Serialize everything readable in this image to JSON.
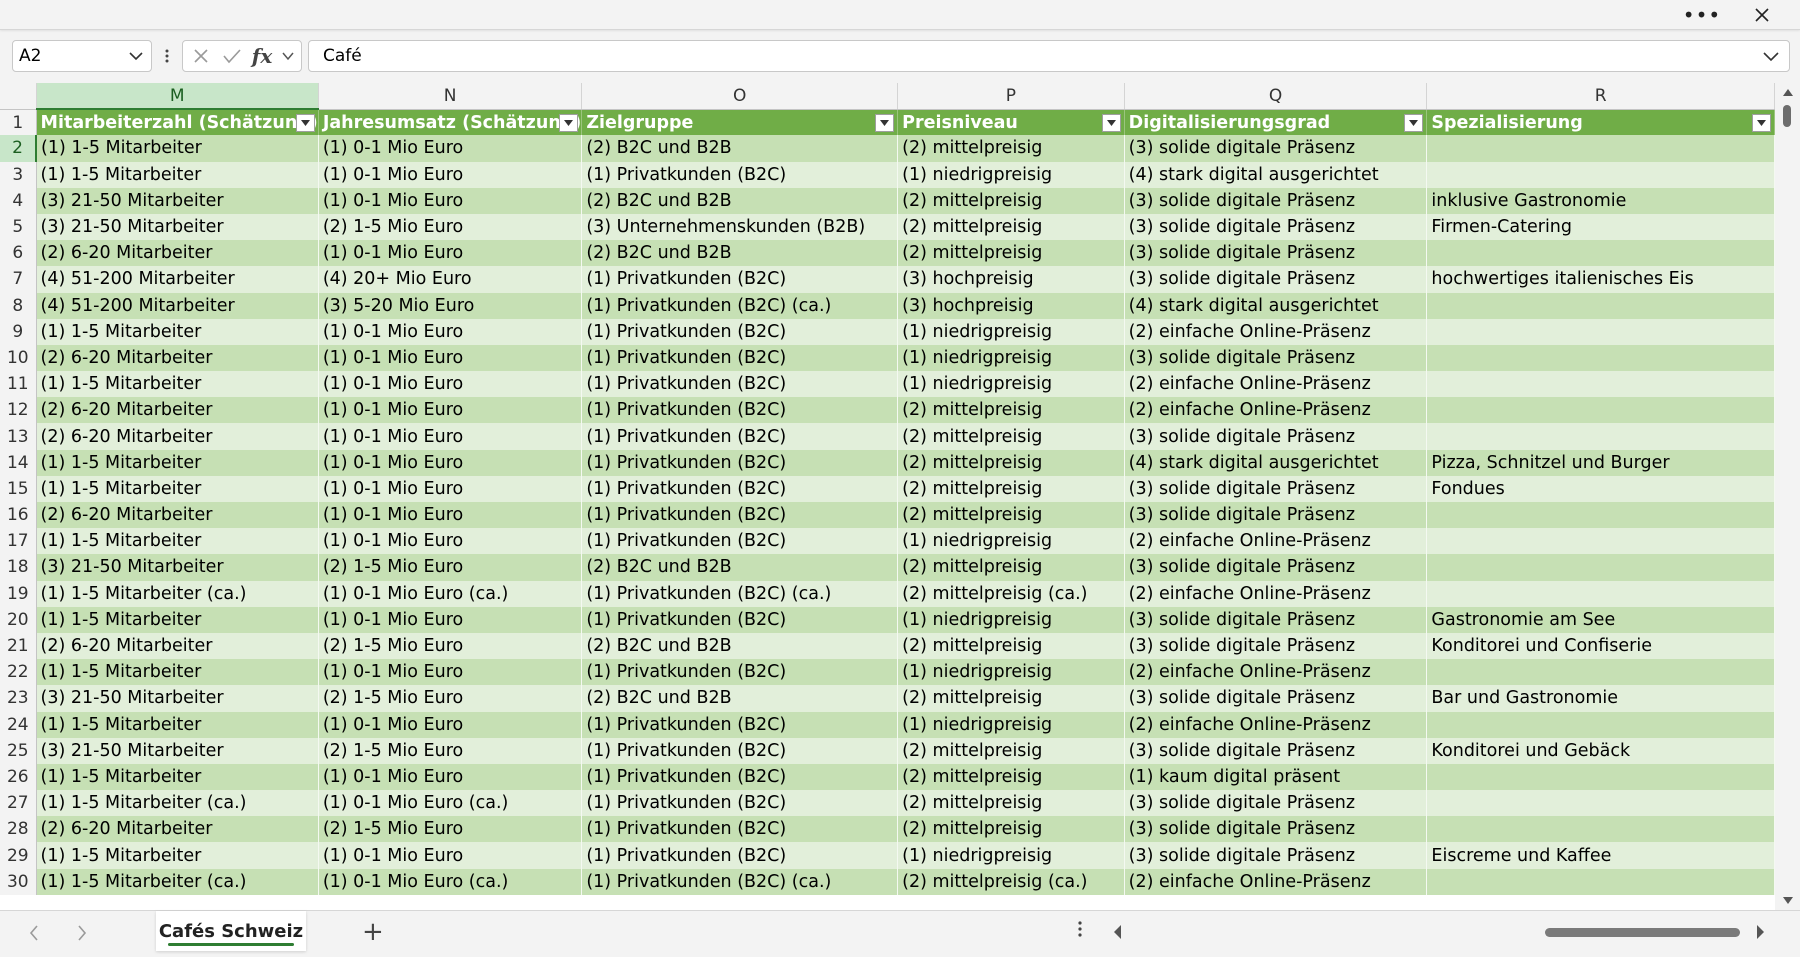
{
  "window": {
    "more_label": "•••"
  },
  "formula_bar": {
    "name_box": "A2",
    "fx_label": "fx",
    "value": "Café"
  },
  "columns": [
    "M",
    "N",
    "O",
    "P",
    "Q",
    "R"
  ],
  "selected_column": "M",
  "headers": [
    "Mitarbeiterzahl (Schätzung)",
    "Jahresumsatz (Schätzung)",
    "Zielgruppe",
    "Preisniveau",
    "Digitalisierungsgrad",
    "Spezialisierung"
  ],
  "rows": [
    {
      "n": "2",
      "cells": [
        "(1) 1-5 Mitarbeiter",
        "(1) 0-1 Mio Euro",
        "(2) B2C und B2B",
        "(2) mittelpreisig",
        "(3) solide digitale Präsenz",
        ""
      ]
    },
    {
      "n": "3",
      "cells": [
        "(1) 1-5 Mitarbeiter",
        "(1) 0-1 Mio Euro",
        "(1) Privatkunden (B2C)",
        "(1) niedrigpreisig",
        "(4) stark digital ausgerichtet",
        ""
      ]
    },
    {
      "n": "4",
      "cells": [
        "(3) 21-50 Mitarbeiter",
        "(1) 0-1 Mio Euro",
        "(2) B2C und B2B",
        "(2) mittelpreisig",
        "(3) solide digitale Präsenz",
        "inklusive Gastronomie"
      ]
    },
    {
      "n": "5",
      "cells": [
        "(3) 21-50 Mitarbeiter",
        "(2) 1-5 Mio Euro",
        "(3) Unternehmenskunden (B2B)",
        "(2) mittelpreisig",
        "(3) solide digitale Präsenz",
        "Firmen-Catering"
      ]
    },
    {
      "n": "6",
      "cells": [
        "(2) 6-20 Mitarbeiter",
        "(1) 0-1 Mio Euro",
        "(2) B2C und B2B",
        "(2) mittelpreisig",
        "(3) solide digitale Präsenz",
        ""
      ]
    },
    {
      "n": "7",
      "cells": [
        "(4) 51-200 Mitarbeiter",
        "(4) 20+ Mio Euro",
        "(1) Privatkunden (B2C)",
        "(3) hochpreisig",
        "(3) solide digitale Präsenz",
        "hochwertiges italienisches Eis"
      ]
    },
    {
      "n": "8",
      "cells": [
        "(4) 51-200 Mitarbeiter",
        "(3) 5-20 Mio Euro",
        "(1) Privatkunden (B2C) (ca.)",
        "(3) hochpreisig",
        "(4) stark digital ausgerichtet",
        ""
      ]
    },
    {
      "n": "9",
      "cells": [
        "(1) 1-5 Mitarbeiter",
        "(1) 0-1 Mio Euro",
        "(1) Privatkunden (B2C)",
        "(1) niedrigpreisig",
        "(2) einfache Online-Präsenz",
        ""
      ]
    },
    {
      "n": "10",
      "cells": [
        "(2) 6-20 Mitarbeiter",
        "(1) 0-1 Mio Euro",
        "(1) Privatkunden (B2C)",
        "(1) niedrigpreisig",
        "(3) solide digitale Präsenz",
        ""
      ]
    },
    {
      "n": "11",
      "cells": [
        "(1) 1-5 Mitarbeiter",
        "(1) 0-1 Mio Euro",
        "(1) Privatkunden (B2C)",
        "(1) niedrigpreisig",
        "(2) einfache Online-Präsenz",
        ""
      ]
    },
    {
      "n": "12",
      "cells": [
        "(2) 6-20 Mitarbeiter",
        "(1) 0-1 Mio Euro",
        "(1) Privatkunden (B2C)",
        "(2) mittelpreisig",
        "(2) einfache Online-Präsenz",
        ""
      ]
    },
    {
      "n": "13",
      "cells": [
        "(2) 6-20 Mitarbeiter",
        "(1) 0-1 Mio Euro",
        "(1) Privatkunden (B2C)",
        "(2) mittelpreisig",
        "(3) solide digitale Präsenz",
        ""
      ]
    },
    {
      "n": "14",
      "cells": [
        "(1) 1-5 Mitarbeiter",
        "(1) 0-1 Mio Euro",
        "(1) Privatkunden (B2C)",
        "(2) mittelpreisig",
        "(4) stark digital ausgerichtet",
        "Pizza, Schnitzel und Burger"
      ]
    },
    {
      "n": "15",
      "cells": [
        "(1) 1-5 Mitarbeiter",
        "(1) 0-1 Mio Euro",
        "(1) Privatkunden (B2C)",
        "(2) mittelpreisig",
        "(3) solide digitale Präsenz",
        "Fondues"
      ]
    },
    {
      "n": "16",
      "cells": [
        "(2) 6-20 Mitarbeiter",
        "(1) 0-1 Mio Euro",
        "(1) Privatkunden (B2C)",
        "(2) mittelpreisig",
        "(3) solide digitale Präsenz",
        ""
      ]
    },
    {
      "n": "17",
      "cells": [
        "(1) 1-5 Mitarbeiter",
        "(1) 0-1 Mio Euro",
        "(1) Privatkunden (B2C)",
        "(1) niedrigpreisig",
        "(2) einfache Online-Präsenz",
        ""
      ]
    },
    {
      "n": "18",
      "cells": [
        "(3) 21-50 Mitarbeiter",
        "(2) 1-5 Mio Euro",
        "(2) B2C und B2B",
        "(2) mittelpreisig",
        "(3) solide digitale Präsenz",
        ""
      ]
    },
    {
      "n": "19",
      "cells": [
        "(1) 1-5 Mitarbeiter (ca.)",
        "(1) 0-1 Mio Euro (ca.)",
        "(1) Privatkunden (B2C) (ca.)",
        "(2) mittelpreisig (ca.)",
        "(2) einfache Online-Präsenz",
        ""
      ]
    },
    {
      "n": "20",
      "cells": [
        "(1) 1-5 Mitarbeiter",
        "(1) 0-1 Mio Euro",
        "(1) Privatkunden (B2C)",
        "(1) niedrigpreisig",
        "(3) solide digitale Präsenz",
        "Gastronomie am See"
      ]
    },
    {
      "n": "21",
      "cells": [
        "(2) 6-20 Mitarbeiter",
        "(2) 1-5 Mio Euro",
        "(2) B2C und B2B",
        "(2) mittelpreisig",
        "(3) solide digitale Präsenz",
        "Konditorei und Confiserie"
      ]
    },
    {
      "n": "22",
      "cells": [
        "(1) 1-5 Mitarbeiter",
        "(1) 0-1 Mio Euro",
        "(1) Privatkunden (B2C)",
        "(1) niedrigpreisig",
        "(2) einfache Online-Präsenz",
        ""
      ]
    },
    {
      "n": "23",
      "cells": [
        "(3) 21-50 Mitarbeiter",
        "(2) 1-5 Mio Euro",
        "(2) B2C und B2B",
        "(2) mittelpreisig",
        "(3) solide digitale Präsenz",
        "Bar und Gastronomie"
      ]
    },
    {
      "n": "24",
      "cells": [
        "(1) 1-5 Mitarbeiter",
        "(1) 0-1 Mio Euro",
        "(1) Privatkunden (B2C)",
        "(1) niedrigpreisig",
        "(2) einfache Online-Präsenz",
        ""
      ]
    },
    {
      "n": "25",
      "cells": [
        "(3) 21-50 Mitarbeiter",
        "(2) 1-5 Mio Euro",
        "(1) Privatkunden (B2C)",
        "(2) mittelpreisig",
        "(3) solide digitale Präsenz",
        "Konditorei und Gebäck"
      ]
    },
    {
      "n": "26",
      "cells": [
        "(1) 1-5 Mitarbeiter",
        "(1) 0-1 Mio Euro",
        "(1) Privatkunden (B2C)",
        "(2) mittelpreisig",
        "(1) kaum digital präsent",
        ""
      ]
    },
    {
      "n": "27",
      "cells": [
        "(1) 1-5 Mitarbeiter (ca.)",
        "(1) 0-1 Mio Euro (ca.)",
        "(1) Privatkunden (B2C)",
        "(2) mittelpreisig",
        "(3) solide digitale Präsenz",
        ""
      ]
    },
    {
      "n": "28",
      "cells": [
        "(2) 6-20 Mitarbeiter",
        "(2) 1-5 Mio Euro",
        "(1) Privatkunden (B2C)",
        "(2) mittelpreisig",
        "(3) solide digitale Präsenz",
        ""
      ]
    },
    {
      "n": "29",
      "cells": [
        "(1) 1-5 Mitarbeiter",
        "(1) 0-1 Mio Euro",
        "(1) Privatkunden (B2C)",
        "(1) niedrigpreisig",
        "(3) solide digitale Präsenz",
        "Eiscreme und Kaffee"
      ]
    },
    {
      "n": "30",
      "cells": [
        "(1) 1-5 Mitarbeiter (ca.)",
        "(1) 0-1 Mio Euro (ca.)",
        "(1) Privatkunden (B2C) (ca.)",
        "(2) mittelpreisig (ca.)",
        "(2) einfache Online-Präsenz",
        ""
      ]
    }
  ],
  "sheet_tabs": [
    {
      "label": "Cafés Schweiz",
      "active": true
    }
  ],
  "add_sheet_label": "+",
  "colors": {
    "header_green": "#70ad47",
    "band_dark": "#c6e0b4",
    "band_light": "#e2efda",
    "selection": "#2e7d32"
  }
}
